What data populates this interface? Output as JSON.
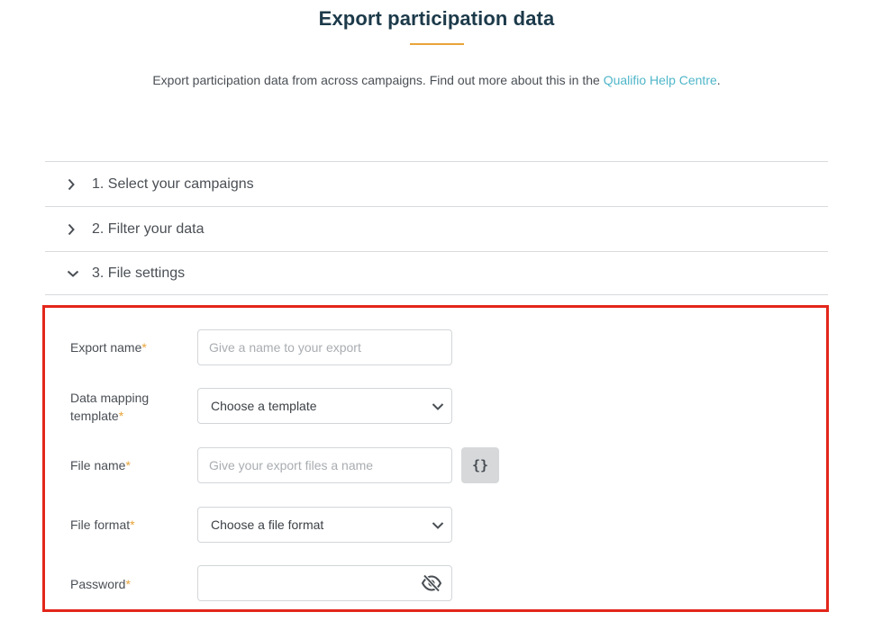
{
  "header": {
    "title": "Export participation data",
    "subtitle_text": "Export participation data from across campaigns. Find out more about this in the",
    "help_link_label": "Qualifio Help Centre",
    "subtitle_end": "."
  },
  "accordion": {
    "sections": [
      {
        "label": "1. Select your campaigns",
        "expanded": false
      },
      {
        "label": "2. Filter your data",
        "expanded": false
      },
      {
        "label": "3. File settings",
        "expanded": true
      }
    ]
  },
  "file_settings": {
    "required_marker": "*",
    "export_name": {
      "label": "Export name",
      "placeholder": "Give a name to your export",
      "value": ""
    },
    "template": {
      "label_line1": "Data mapping",
      "label_line2": "template",
      "selected": "Choose a template"
    },
    "file_name": {
      "label": "File name",
      "placeholder": "Give your export files a name",
      "value": "",
      "variable_button": "{}"
    },
    "file_format": {
      "label": "File format",
      "selected": "Choose a file format"
    },
    "password": {
      "label": "Password",
      "value": "",
      "toggle_icon": "eye-slash-icon"
    }
  },
  "colors": {
    "title": "#1c3a4a",
    "accent": "#e8a43a",
    "link": "#4fb6c9",
    "highlight_border": "#e3261b"
  }
}
